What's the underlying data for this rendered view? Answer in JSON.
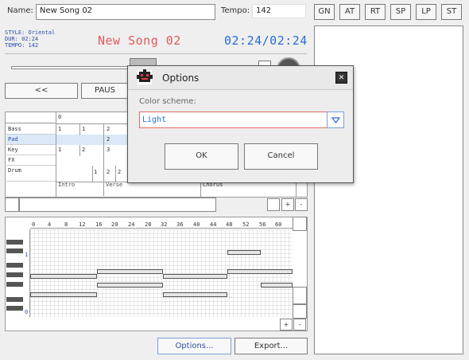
{
  "header": {
    "name_label": "Name:",
    "name_value": "New Song 02",
    "tempo_label": "Tempo:",
    "tempo_value": "142"
  },
  "top_tabs": [
    "GN",
    "AT",
    "RT",
    "SP",
    "LP",
    "ST"
  ],
  "song_info": {
    "style": "STYLE: Oriental",
    "duration": "DUR: 02:24",
    "tempo": "TEMPO: 142",
    "title": "New Song 02",
    "time": "02:24/02:24"
  },
  "transport": {
    "rewind_label": "<<",
    "pause_label": "PAUS"
  },
  "arranger": {
    "bar_start": "0",
    "tracks": [
      "Bass",
      "Pad",
      "Key",
      "FX",
      "Drum"
    ],
    "sections": [
      "Intro",
      "Verse",
      "Chorus"
    ],
    "cells": {
      "bass": [
        "1",
        "1",
        "2"
      ],
      "pad": [
        "2"
      ],
      "key": [
        "1",
        "2",
        "3"
      ],
      "drum": [
        "1",
        "2",
        "2"
      ]
    },
    "plus_label": "+",
    "minus_label": "-"
  },
  "piano_roll": {
    "ruler": [
      "0",
      "4",
      "8",
      "12",
      "16",
      "20",
      "24",
      "28",
      "32",
      "36",
      "40",
      "44",
      "48",
      "52",
      "56",
      "60"
    ],
    "octave_top": "1",
    "octave_bottom": "0",
    "plus_label": "+",
    "minus_label": "-"
  },
  "footer": {
    "options_label": "Options...",
    "export_label": "Export..."
  },
  "dialog": {
    "title": "Options",
    "close_label": "✕",
    "scheme_label": "Color scheme:",
    "scheme_value": "Light",
    "ok_label": "OK",
    "cancel_label": "Cancel"
  },
  "colors": {
    "title_red": "#e45a5a",
    "time_blue": "#2b6cd6",
    "info_blue": "#2b4fa8",
    "select_border": "#e06a6a",
    "highlight_row": "#dce8f8"
  }
}
